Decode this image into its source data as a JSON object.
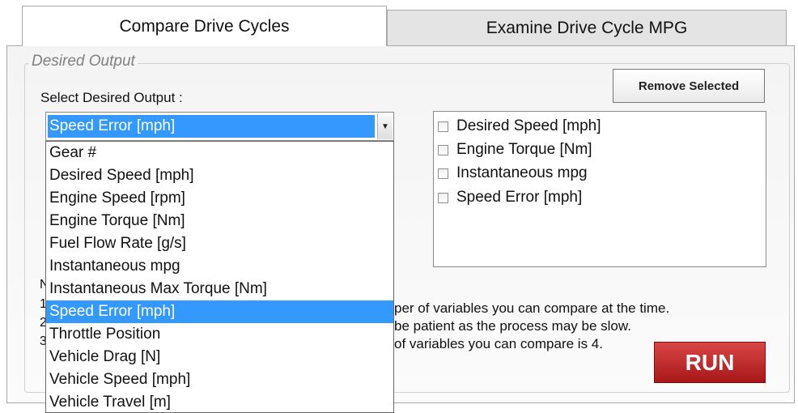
{
  "tabs": [
    {
      "label": "Compare Drive Cycles"
    },
    {
      "label": "Examine Drive Cycle MPG"
    }
  ],
  "group": {
    "legend": "Desired Output"
  },
  "select_label": "Select Desired Output :",
  "combo": {
    "value": "Speed Error [mph]"
  },
  "dropdown_options": [
    "Gear #",
    "Desired Speed [mph]",
    "Engine Speed [rpm]",
    "Engine Torque [Nm]",
    "Fuel Flow Rate [g/s]",
    "Instantaneous mpg",
    "Instantaneous Max Torque [Nm]",
    "Speed Error [mph]",
    "Throttle Position",
    "Vehicle Drag [N]",
    "Vehicle Speed [mph]",
    "Vehicle Travel [m]"
  ],
  "selected_list": [
    "Desired Speed [mph]",
    "Engine Torque [Nm]",
    "Instantaneous mpg",
    "Speed Error [mph]"
  ],
  "remove_button": "Remove Selected",
  "notes": {
    "partial_heading": "N",
    "line1_prefix": "1",
    "line2_prefix": "2",
    "line3_prefix": "3",
    "line1": "per of variables you can compare at the time.",
    "line2": "be patient as the process may be slow.",
    "line3": "of variables you can compare is 4."
  },
  "run_button": "RUN",
  "colors": {
    "highlight": "#3399ff",
    "run": "#c0282d"
  }
}
